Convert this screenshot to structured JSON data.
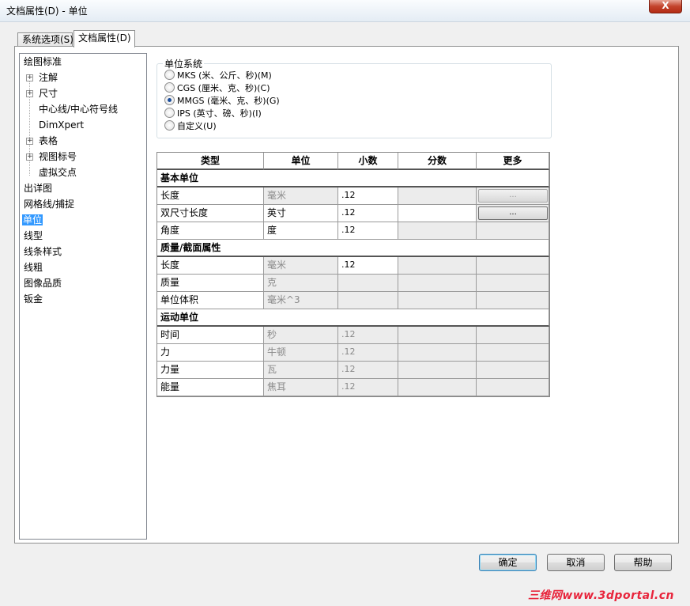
{
  "window": {
    "title": "文档属性(D) - 单位",
    "close_label": "X"
  },
  "tabs": [
    {
      "label": "系统选项(S)"
    },
    {
      "label": "文档属性(D)"
    }
  ],
  "tree": {
    "items": [
      {
        "label": "绘图标准"
      },
      {
        "label": "注解"
      },
      {
        "label": "尺寸"
      },
      {
        "label": "中心线/中心符号线"
      },
      {
        "label": "DimXpert"
      },
      {
        "label": "表格"
      },
      {
        "label": "视图标号"
      },
      {
        "label": "虚拟交点"
      },
      {
        "label": "出详图"
      },
      {
        "label": "网格线/捕捉"
      },
      {
        "label": "单位"
      },
      {
        "label": "线型"
      },
      {
        "label": "线条样式"
      },
      {
        "label": "线粗"
      },
      {
        "label": "图像品质"
      },
      {
        "label": "钣金"
      }
    ]
  },
  "unit_system": {
    "title": "单位系统",
    "options": [
      {
        "label": "MKS (米、公斤、秒)(M)",
        "checked": false
      },
      {
        "label": "CGS (厘米、克、秒)(C)",
        "checked": false
      },
      {
        "label": "MMGS (毫米、克、秒)(G)",
        "checked": true
      },
      {
        "label": "IPS (英寸、磅、秒)(I)",
        "checked": false
      },
      {
        "label": "自定义(U)",
        "checked": false
      }
    ]
  },
  "table": {
    "headers": [
      "类型",
      "单位",
      "小数",
      "分数",
      "更多"
    ],
    "sections": [
      {
        "title": "基本单位",
        "rows": [
          {
            "type": "长度",
            "unit": "毫米",
            "decimal": ".12",
            "more": "..."
          },
          {
            "type": "双尺寸长度",
            "unit": "英寸",
            "decimal": ".12",
            "more": "..."
          },
          {
            "type": "角度",
            "unit": "度",
            "decimal": ".12",
            "more": ""
          }
        ]
      },
      {
        "title": "质量/截面属性",
        "rows": [
          {
            "type": "长度",
            "unit": "毫米",
            "decimal": ".12"
          },
          {
            "type": "质量",
            "unit": "克",
            "decimal": ""
          },
          {
            "type": "单位体积",
            "unit": "毫米^3",
            "decimal": ""
          }
        ]
      },
      {
        "title": "运动单位",
        "rows": [
          {
            "type": "时间",
            "unit": "秒",
            "decimal": ".12"
          },
          {
            "type": "力",
            "unit": "牛顿",
            "decimal": ".12"
          },
          {
            "type": "力量",
            "unit": "瓦",
            "decimal": ".12"
          },
          {
            "type": "能量",
            "unit": "焦耳",
            "decimal": ".12"
          }
        ]
      }
    ]
  },
  "buttons": {
    "ok": "确定",
    "cancel": "取消",
    "help": "帮助"
  },
  "watermark": "三维网www.3dportal.cn"
}
